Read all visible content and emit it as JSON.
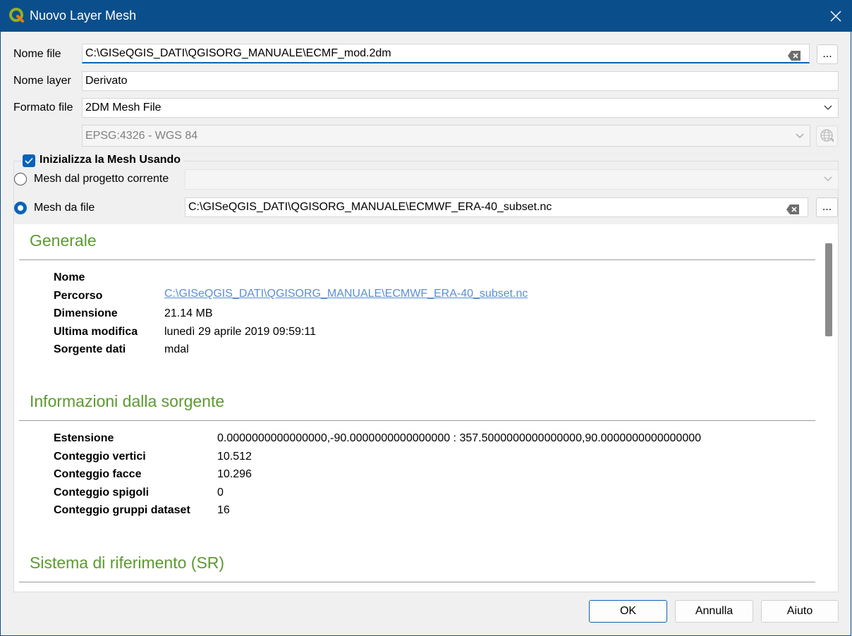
{
  "window": {
    "title": "Nuovo Layer Mesh"
  },
  "form": {
    "file_name_label": "Nome file",
    "file_name_value": "C:\\GISeQGIS_DATI\\QGISORG_MANUALE\\ECMF_mod.2dm",
    "browse_label": "...",
    "layer_name_label": "Nome layer",
    "layer_name_value": "Derivato",
    "format_label": "Formato file",
    "format_value": "2DM Mesh File",
    "crs_value": "EPSG:4326 - WGS 84"
  },
  "init_group": {
    "checkbox_label": "Inizializza la Mesh Usando",
    "checked": true,
    "option_project_label": "Mesh dal progetto corrente",
    "option_project_value": "",
    "option_file_label": "Mesh da file",
    "option_file_value": "C:\\GISeQGIS_DATI\\QGISORG_MANUALE\\ECMWF_ERA-40_subset.nc",
    "selected_option": "Mesh da file",
    "browse_label": "..."
  },
  "info": {
    "general": {
      "title": "Generale",
      "rows": [
        {
          "key": "Nome",
          "value": ""
        },
        {
          "key": "Percorso",
          "value": "C:\\GISeQGIS_DATI\\QGISORG_MANUALE\\ECMWF_ERA-40_subset.nc"
        },
        {
          "key": "Dimensione",
          "value": "21.14 MB"
        },
        {
          "key": "Ultima modifica",
          "value": "lunedì 29 aprile 2019 09:59:11"
        },
        {
          "key": "Sorgente dati",
          "value": "mdal"
        }
      ]
    },
    "source": {
      "title": "Informazioni dalla sorgente",
      "rows": [
        {
          "key": "Estensione",
          "value": "0.0000000000000000,-90.0000000000000000 : 357.5000000000000000,90.0000000000000000"
        },
        {
          "key": "Conteggio vertici",
          "value": "10.512"
        },
        {
          "key": "Conteggio facce",
          "value": "10.296"
        },
        {
          "key": "Conteggio spigoli",
          "value": "0"
        },
        {
          "key": "Conteggio gruppi dataset",
          "value": "16"
        }
      ]
    },
    "crs": {
      "title": "Sistema di riferimento (SR)"
    }
  },
  "buttons": {
    "ok": "OK",
    "cancel": "Annulla",
    "help": "Aiuto"
  },
  "colors": {
    "title_bar": "#0a4f8c",
    "accent": "#0a63b8",
    "section_title": "#5c9a2e",
    "link": "#5b8ed6"
  },
  "icons": {
    "app": "qgis-logo-icon",
    "close": "close-icon",
    "clear": "clear-text-icon",
    "dropdown": "chevron-down-icon",
    "crs": "globe-crs-icon"
  }
}
